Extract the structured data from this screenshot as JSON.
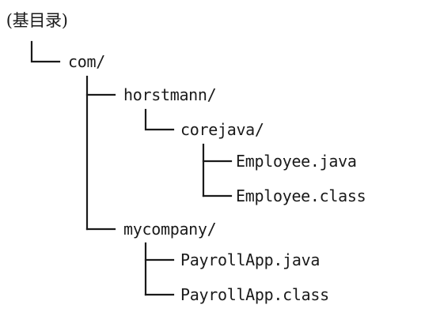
{
  "tree": {
    "root": ". (基目录)",
    "com": "com/",
    "horstmann": "horstmann/",
    "corejava": "corejava/",
    "employee_java": "Employee.java",
    "employee_class": "Employee.class",
    "mycompany": "mycompany/",
    "payroll_java": "PayrollApp.java",
    "payroll_class": "PayrollApp.class"
  },
  "line_color": "#1a1a1a"
}
